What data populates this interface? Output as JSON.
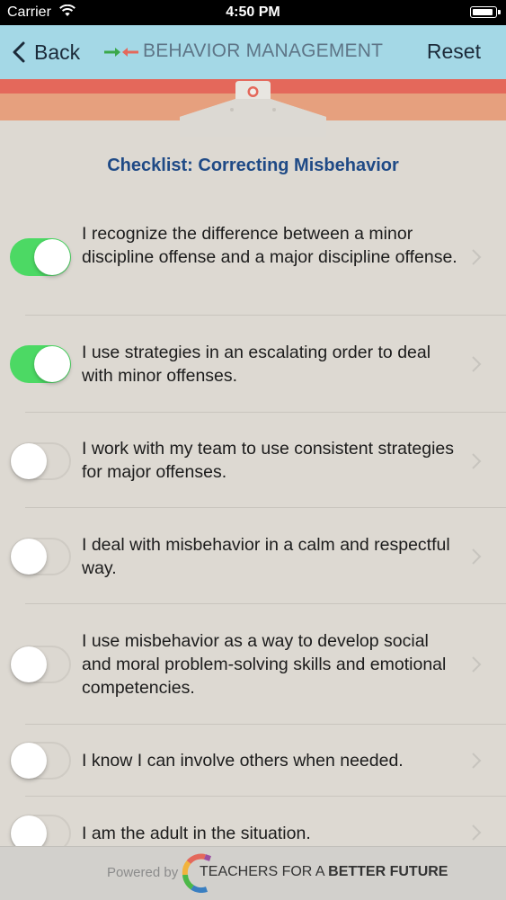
{
  "status_bar": {
    "carrier": "Carrier",
    "time": "4:50 PM",
    "battery_level": 0.95
  },
  "nav": {
    "back_label": "Back",
    "title": "BEHAVIOR MANAGEMENT",
    "reset_label": "Reset"
  },
  "checklist": {
    "title": "Checklist: Correcting Misbehavior",
    "items": [
      {
        "text": "I recognize the difference between a minor discipline offense and a major discipline offense.",
        "checked": true
      },
      {
        "text": "I use strategies in an escalating order to deal with minor offenses.",
        "checked": true
      },
      {
        "text": "I work with my team to use consistent strategies for major offenses.",
        "checked": false
      },
      {
        "text": "I deal with misbehavior in a calm and respectful way.",
        "checked": false
      },
      {
        "text": "I use misbehavior as a way to develop social and moral problem-solving skills and emotional competencies.",
        "checked": false
      },
      {
        "text": "I know I can involve others when needed.",
        "checked": false
      },
      {
        "text": "I am the adult in the situation.",
        "checked": false
      }
    ]
  },
  "footer": {
    "powered_by": "Powered by",
    "brand_prefix": "TEACHERS FOR A ",
    "brand_bold": "BETTER FUTURE"
  },
  "colors": {
    "toggle_on": "#4cd964",
    "nav_bg": "#a4d8e6",
    "title_blue": "#1f4a86",
    "stripe_red": "#e4685b",
    "stripe_orange": "#e6a07e"
  }
}
